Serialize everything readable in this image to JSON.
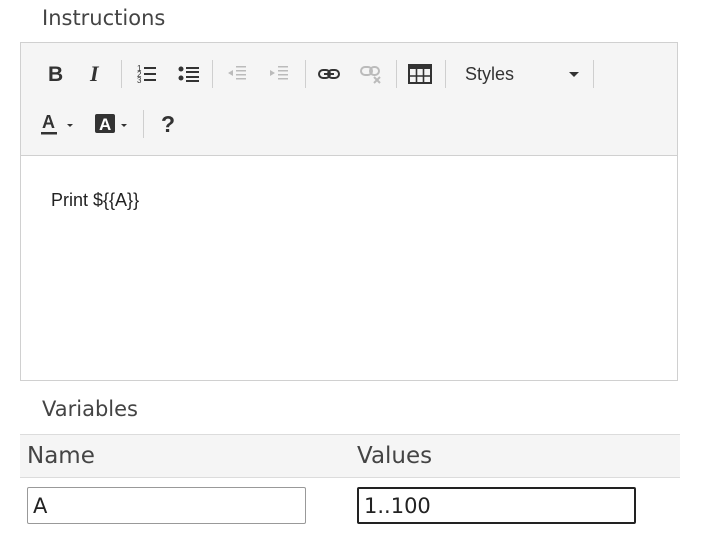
{
  "instructions_section": {
    "label": "Instructions"
  },
  "toolbar": {
    "buttons": [
      {
        "name": "bold-button",
        "icon": "bold-icon"
      },
      {
        "name": "italic-button",
        "icon": "italic-icon"
      },
      {
        "name": "numbered-list-button",
        "icon": "numbered-list-icon"
      },
      {
        "name": "bulleted-list-button",
        "icon": "bulleted-list-icon"
      },
      {
        "name": "decrease-indent-button",
        "icon": "outdent-icon",
        "disabled": true
      },
      {
        "name": "increase-indent-button",
        "icon": "indent-icon",
        "disabled": true
      },
      {
        "name": "link-button",
        "icon": "link-icon"
      },
      {
        "name": "unlink-button",
        "icon": "unlink-icon",
        "disabled": true
      },
      {
        "name": "table-button",
        "icon": "table-icon"
      },
      {
        "name": "text-color-button",
        "icon": "text-color-icon"
      },
      {
        "name": "background-color-button",
        "icon": "background-color-icon"
      },
      {
        "name": "help-button",
        "icon": "help-icon"
      }
    ],
    "styles_dropdown": {
      "label": "Styles"
    }
  },
  "editor": {
    "content": "Print ${{A}}"
  },
  "variables_section": {
    "label": "Variables",
    "columns": [
      "Name",
      "Values"
    ],
    "rows": [
      {
        "name": "A",
        "values": "1..100"
      }
    ]
  },
  "colors": {
    "toolbar_bg": "#f5f5f5",
    "border": "#d0d0d0",
    "text": "#333333"
  }
}
